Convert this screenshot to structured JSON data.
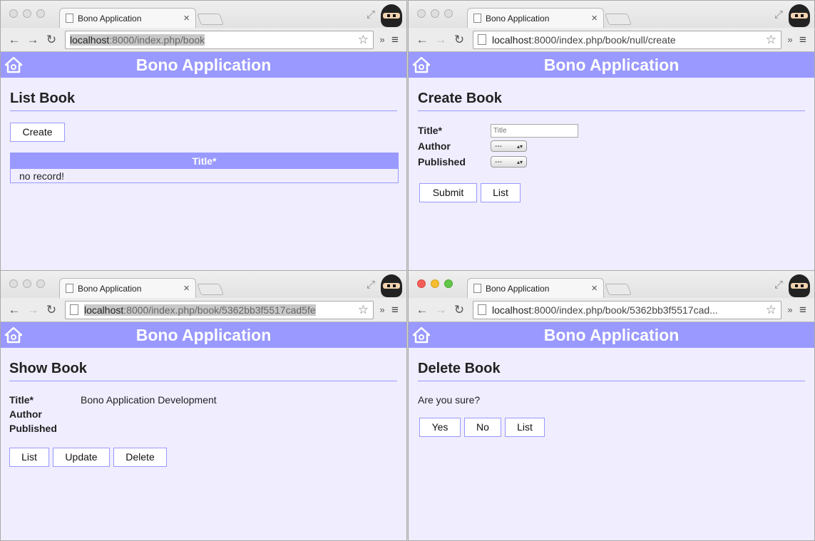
{
  "windows": {
    "list": {
      "tab_title": "Bono Application",
      "url_host": "localhost",
      "url_rest": ":8000/index.php/book",
      "brand": "Bono Application",
      "heading": "List Book",
      "create_label": "Create",
      "table_header": "Title*",
      "empty_message": "no record!"
    },
    "create": {
      "tab_title": "Bono Application",
      "url_host": "localhost",
      "url_rest": ":8000/index.php/book/null/create",
      "brand": "Bono Application",
      "heading": "Create Book",
      "fields": {
        "title_label": "Title*",
        "title_placeholder": "Title",
        "author_label": "Author",
        "author_value": "---",
        "published_label": "Published",
        "published_value": "---"
      },
      "submit_label": "Submit",
      "list_label": "List"
    },
    "show": {
      "tab_title": "Bono Application",
      "url_host": "localhost",
      "url_rest": ":8000/index.php/book/5362bb3f5517cad5fe",
      "brand": "Bono Application",
      "heading": "Show Book",
      "fields": {
        "title_label": "Title*",
        "title_value": "Bono Application Development",
        "author_label": "Author",
        "published_label": "Published"
      },
      "list_label": "List",
      "update_label": "Update",
      "delete_label": "Delete"
    },
    "delete": {
      "tab_title": "Bono Application",
      "url_host": "localhost",
      "url_rest": ":8000/index.php/book/5362bb3f5517cad...",
      "brand": "Bono Application",
      "heading": "Delete Book",
      "message": "Are you sure?",
      "yes_label": "Yes",
      "no_label": "No",
      "list_label": "List"
    }
  },
  "colors": {
    "header_bg": "#9999ff",
    "page_bg": "#f0edff",
    "accent_border": "#9999ff"
  },
  "icons": [
    "page-icon",
    "close-icon",
    "back-icon",
    "forward-icon",
    "reload-icon",
    "star-icon",
    "menu-icon",
    "home-icon",
    "fullscreen-icon",
    "incognito-avatar-icon"
  ]
}
